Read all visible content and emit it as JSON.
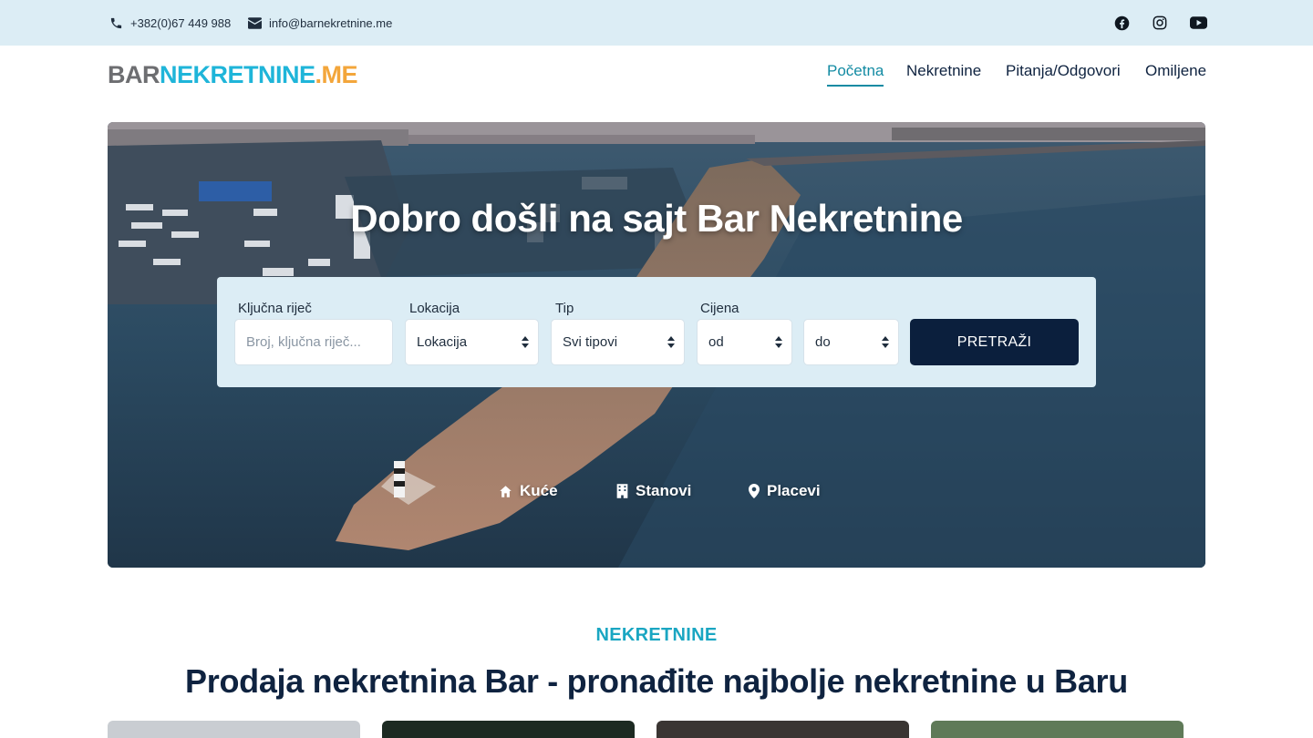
{
  "topbar": {
    "phone": "+382(0)67 449 988",
    "email": "info@barnekretnine.me",
    "social": [
      "facebook-icon",
      "instagram-icon",
      "youtube-icon"
    ]
  },
  "logo": {
    "part1": "BAR",
    "part2": "NEKRETNINE",
    "part3": ".ME"
  },
  "nav": {
    "items": [
      {
        "label": "Početna",
        "active": true
      },
      {
        "label": "Nekretnine",
        "active": false
      },
      {
        "label": "Pitanja/Odgovori",
        "active": false
      },
      {
        "label": "Omiljene",
        "active": false
      }
    ]
  },
  "hero": {
    "title": "Dobro došli na sajt Bar Nekretnine",
    "search": {
      "keyword_label": "Ključna riječ",
      "keyword_placeholder": "Broj, ključna riječ...",
      "location_label": "Lokacija",
      "location_value": "Lokacija",
      "type_label": "Tip",
      "type_value": "Svi tipovi",
      "price_label": "Cijena",
      "price_from": "od",
      "price_to": "do",
      "submit_label": "PRETRAŽI"
    },
    "categories": [
      {
        "label": "Kuće",
        "icon": "house-icon"
      },
      {
        "label": "Stanovi",
        "icon": "building-icon"
      },
      {
        "label": "Placevi",
        "icon": "map-pin-icon"
      }
    ]
  },
  "section": {
    "kicker": "NEKRETNINE",
    "title": "Prodaja nekretnina Bar - pronađite najbolje nekretnine u Baru"
  },
  "colors": {
    "accent": "#138ba3",
    "kicker": "#1aa6c2",
    "navy": "#0b1f3d",
    "topbar_bg": "#dcedf5"
  }
}
